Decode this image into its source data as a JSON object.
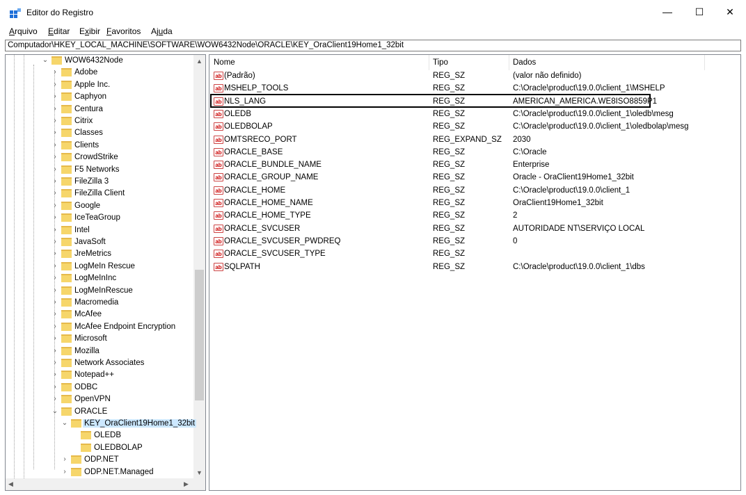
{
  "window": {
    "title": "Editor do Registro",
    "minimize": "—",
    "maximize": "☐",
    "close": "✕"
  },
  "menu": [
    {
      "key": "A",
      "rest": "rquivo"
    },
    {
      "key": "E",
      "rest": "ditar"
    },
    {
      "key": "x",
      "pre": "E",
      "rest": "ibir"
    },
    {
      "key": "F",
      "rest": "avoritos"
    },
    {
      "pre": "Aj",
      "key": "u",
      "rest": "da"
    }
  ],
  "address": "Computador\\HKEY_LOCAL_MACHINE\\SOFTWARE\\WOW6432Node\\ORACLE\\KEY_OraClient19Home1_32bit",
  "tree": {
    "root": "WOW6432Node",
    "children": [
      "Adobe",
      "Apple Inc.",
      "Caphyon",
      "Centura",
      "Citrix",
      "Classes",
      "Clients",
      "CrowdStrike",
      "F5 Networks",
      "FileZilla 3",
      "FileZilla Client",
      "Google",
      "IceTeaGroup",
      "Intel",
      "JavaSoft",
      "JreMetrics",
      "LogMeIn Rescue",
      "LogMeInInc",
      "LogMeInRescue",
      "Macromedia",
      "McAfee",
      "McAfee Endpoint Encryption",
      "Microsoft",
      "Mozilla",
      "Network Associates",
      "Notepad++",
      "ODBC",
      "OpenVPN",
      "ORACLE"
    ],
    "selected": "KEY_OraClient19Home1_32bit",
    "selected_children": [
      "OLEDB",
      "OLEDBOLAP"
    ],
    "oracle_after": [
      "ODP.NET",
      "ODP.NET.Managed"
    ]
  },
  "columns": {
    "name": "Nome",
    "type": "Tipo",
    "data": "Dados"
  },
  "values": [
    {
      "name": "(Padrão)",
      "type": "REG_SZ",
      "data": "(valor não definido)"
    },
    {
      "name": "MSHELP_TOOLS",
      "type": "REG_SZ",
      "data": "C:\\Oracle\\product\\19.0.0\\client_1\\MSHELP"
    },
    {
      "name": "NLS_LANG",
      "type": "REG_SZ",
      "data": "AMERICAN_AMERICA.WE8ISO8859P1"
    },
    {
      "name": "OLEDB",
      "type": "REG_SZ",
      "data": "C:\\Oracle\\product\\19.0.0\\client_1\\oledb\\mesg"
    },
    {
      "name": "OLEDBOLAP",
      "type": "REG_SZ",
      "data": "C:\\Oracle\\product\\19.0.0\\client_1\\oledbolap\\mesg"
    },
    {
      "name": "OMTSRECO_PORT",
      "type": "REG_EXPAND_SZ",
      "data": "2030"
    },
    {
      "name": "ORACLE_BASE",
      "type": "REG_SZ",
      "data": "C:\\Oracle"
    },
    {
      "name": "ORACLE_BUNDLE_NAME",
      "type": "REG_SZ",
      "data": "Enterprise"
    },
    {
      "name": "ORACLE_GROUP_NAME",
      "type": "REG_SZ",
      "data": "Oracle - OraClient19Home1_32bit"
    },
    {
      "name": "ORACLE_HOME",
      "type": "REG_SZ",
      "data": "C:\\Oracle\\product\\19.0.0\\client_1"
    },
    {
      "name": "ORACLE_HOME_NAME",
      "type": "REG_SZ",
      "data": "OraClient19Home1_32bit"
    },
    {
      "name": "ORACLE_HOME_TYPE",
      "type": "REG_SZ",
      "data": "2"
    },
    {
      "name": "ORACLE_SVCUSER",
      "type": "REG_SZ",
      "data": "AUTORIDADE NT\\SERVIÇO LOCAL"
    },
    {
      "name": "ORACLE_SVCUSER_PWDREQ",
      "type": "REG_SZ",
      "data": "0"
    },
    {
      "name": "ORACLE_SVCUSER_TYPE",
      "type": "REG_SZ",
      "data": ""
    },
    {
      "name": "SQLPATH",
      "type": "REG_SZ",
      "data": "C:\\Oracle\\product\\19.0.0\\client_1\\dbs"
    }
  ],
  "value_icon": "ab",
  "colors": {
    "folder": "#f6d66b",
    "selection": "#cce8ff"
  }
}
